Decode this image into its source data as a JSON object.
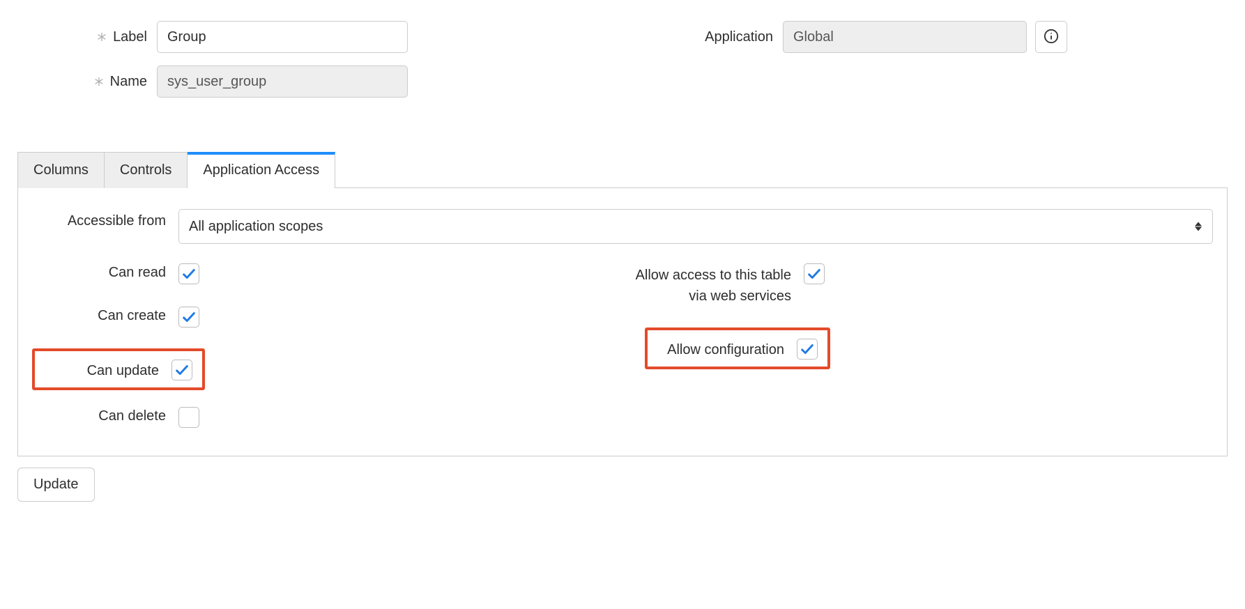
{
  "form": {
    "label_field": {
      "label": "Label",
      "value": "Group"
    },
    "name_field": {
      "label": "Name",
      "value": "sys_user_group"
    },
    "application_field": {
      "label": "Application",
      "value": "Global"
    }
  },
  "tabs": {
    "columns": "Columns",
    "controls": "Controls",
    "app_access": "Application Access"
  },
  "access": {
    "accessible_from_label": "Accessible from",
    "accessible_from_value": "All application scopes",
    "can_read": "Can read",
    "can_create": "Can create",
    "can_update": "Can update",
    "can_delete": "Can delete",
    "allow_web": "Allow access to this table via web services",
    "allow_config": "Allow configuration"
  },
  "buttons": {
    "update": "Update"
  }
}
